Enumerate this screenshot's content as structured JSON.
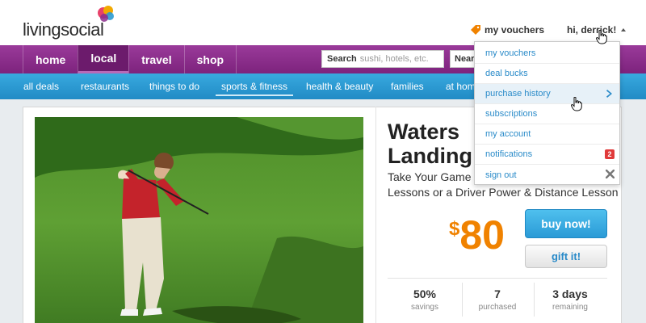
{
  "header": {
    "logo_text": "livingsocial",
    "vouchers_label": "my vouchers",
    "greeting": "hi, derrick!"
  },
  "primary_nav": {
    "tabs": [
      {
        "label": "home"
      },
      {
        "label": "local"
      },
      {
        "label": "travel"
      },
      {
        "label": "shop"
      }
    ],
    "active_tab": "local",
    "search_label": "Search",
    "search_placeholder": "sushi, hotels, etc.",
    "near_label": "Near"
  },
  "secondary_nav": {
    "items": [
      {
        "label": "all deals"
      },
      {
        "label": "restaurants"
      },
      {
        "label": "things to do"
      },
      {
        "label": "sports & fitness"
      },
      {
        "label": "health & beauty"
      },
      {
        "label": "families"
      },
      {
        "label": "at hom"
      }
    ],
    "active_item": "sports & fitness"
  },
  "deal": {
    "title": "Waters Landing",
    "subtitle_line1": "Take Your Game to t",
    "subtitle_line2": "Lessons or a Driver Power & Distance Lesson",
    "currency": "$",
    "price": "80",
    "buy_label": "buy now!",
    "gift_label": "gift it!",
    "stats": [
      {
        "value": "50%",
        "label": "savings"
      },
      {
        "value": "7",
        "label": "purchased"
      },
      {
        "value": "3 days",
        "label": "remaining"
      }
    ]
  },
  "dropdown": {
    "items": [
      {
        "label": "my vouchers"
      },
      {
        "label": "deal bucks"
      },
      {
        "label": "purchase history"
      },
      {
        "label": "subscriptions"
      },
      {
        "label": "my account"
      },
      {
        "label": "notifications",
        "badge": "2"
      },
      {
        "label": "sign out"
      }
    ],
    "hovered_item": "purchase history"
  },
  "colors": {
    "brand_purple": "#8c2f8c",
    "nav_blue": "#2b9bd3",
    "price_orange": "#f08200",
    "link_blue": "#2a8bc9",
    "badge_red": "#e03a3a"
  },
  "icons": [
    "tag-icon",
    "caret-up-icon",
    "chevron-right-icon",
    "close-icon",
    "hand-cursor-icon"
  ]
}
